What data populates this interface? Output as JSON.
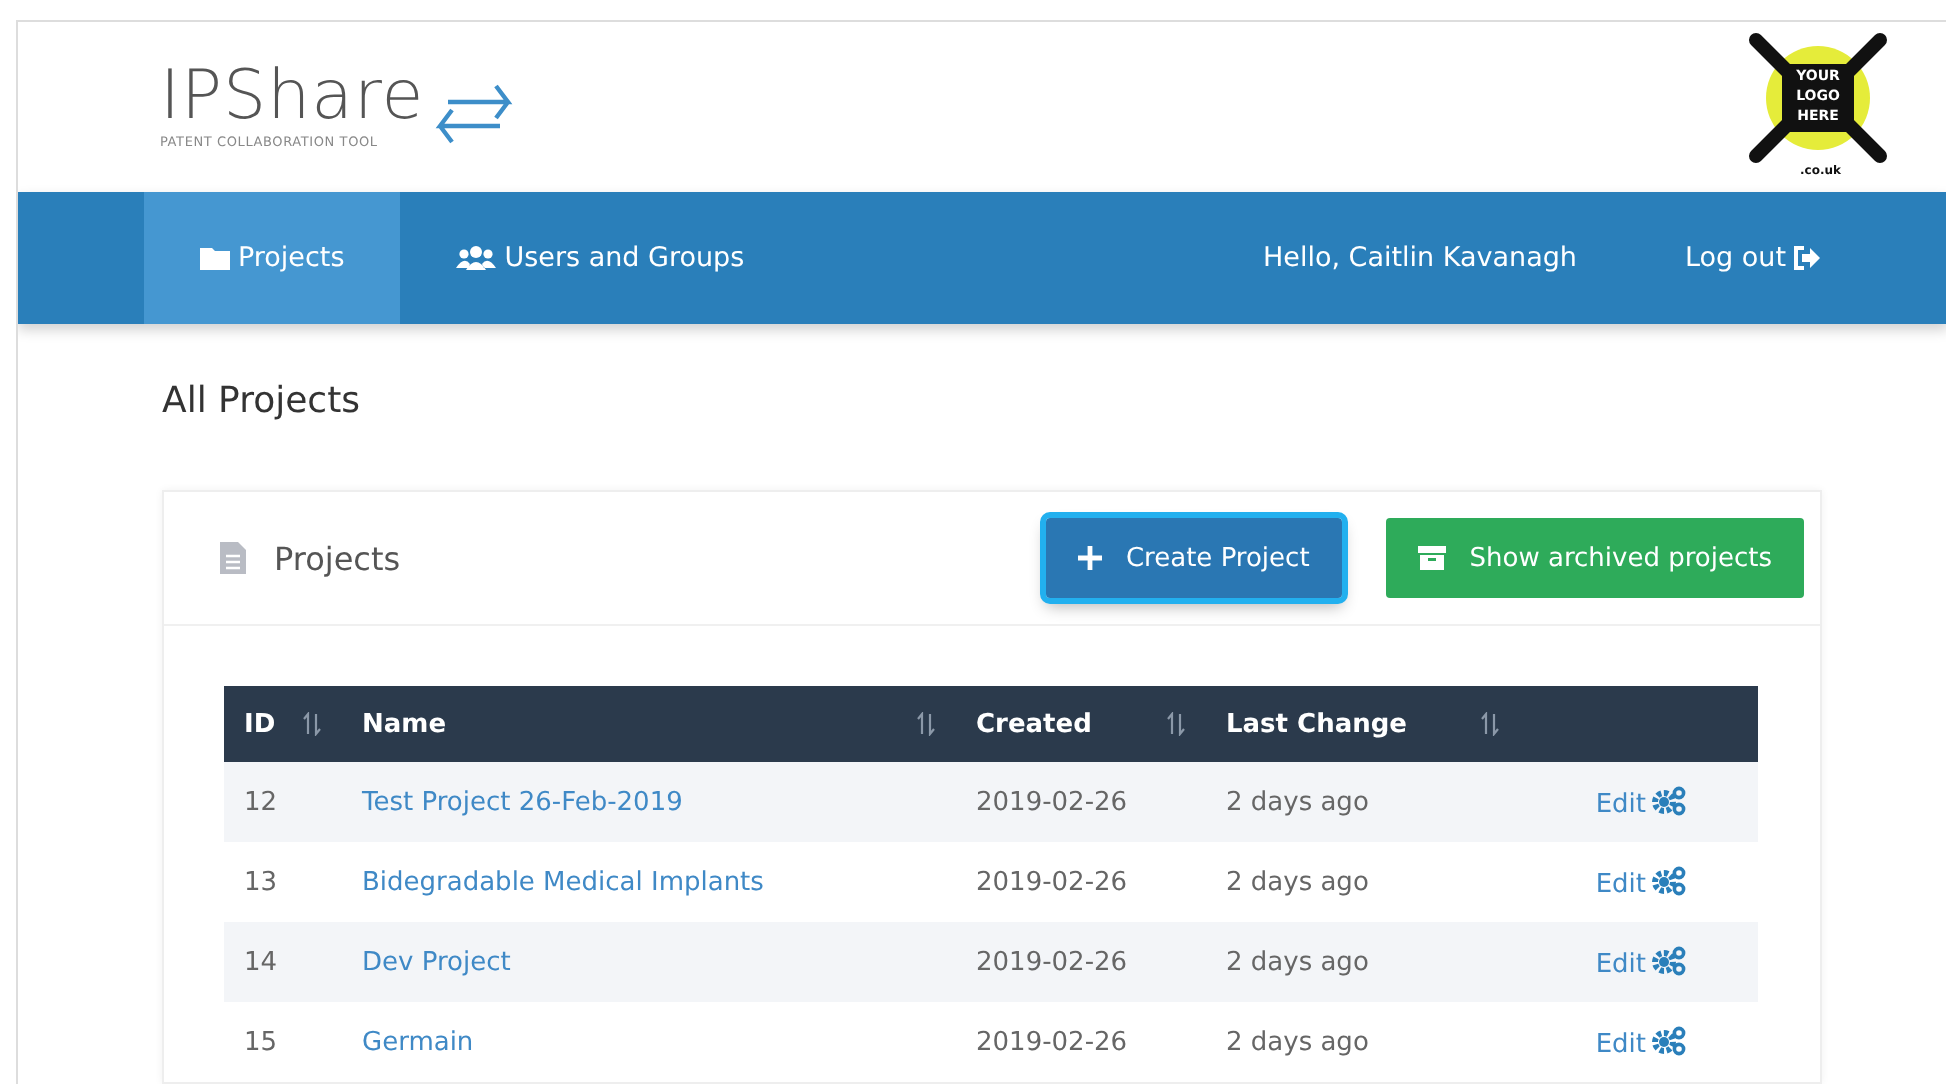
{
  "brand": {
    "name": "IPShare",
    "tagline": "PATENT COLLABORATION TOOL"
  },
  "logo_badge": {
    "lines": [
      "YOUR",
      "LOGO",
      "HERE"
    ],
    "suffix": ".co.uk"
  },
  "nav": {
    "items": [
      {
        "label": "Projects",
        "selected": true
      },
      {
        "label": "Users and Groups",
        "selected": false
      }
    ],
    "greeting": "Hello, Caitlin Kavanagh",
    "logout": "Log out"
  },
  "page_title": "All Projects",
  "panel": {
    "title": "Projects",
    "buttons": [
      {
        "label": "Create Project",
        "kind": "primary"
      },
      {
        "label": "Show archived projects",
        "kind": "success"
      }
    ]
  },
  "table": {
    "columns": [
      "ID",
      "Name",
      "Created",
      "Last Change"
    ],
    "rows": [
      {
        "id": "12",
        "name": "Test Project 26-Feb-2019",
        "created": "2019-02-26",
        "last_change": "2 days ago",
        "action": "Edit"
      },
      {
        "id": "13",
        "name": "Bidegradable Medical Implants",
        "created": "2019-02-26",
        "last_change": "2 days ago",
        "action": "Edit"
      },
      {
        "id": "14",
        "name": "Dev Project",
        "created": "2019-02-26",
        "last_change": "2 days ago",
        "action": "Edit"
      },
      {
        "id": "15",
        "name": "Germain",
        "created": "2019-02-26",
        "last_change": "2 days ago",
        "action": "Edit"
      }
    ]
  }
}
